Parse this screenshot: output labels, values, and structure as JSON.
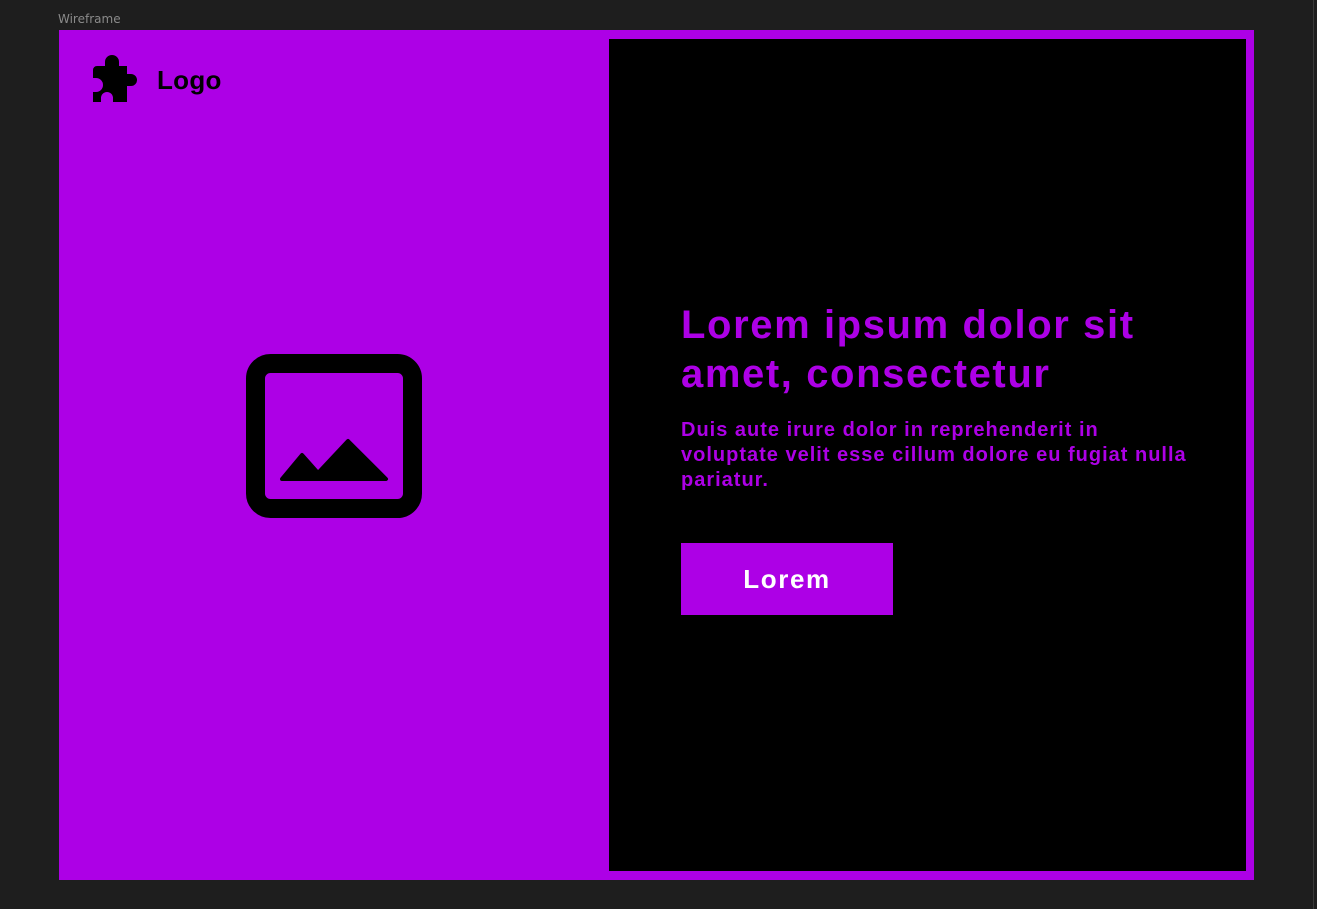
{
  "canvas": {
    "frame_label": "Wireframe",
    "background_color": "#1e1e1e"
  },
  "brand": {
    "accent_color": "#ad00e6",
    "panel_color": "#000000"
  },
  "logo": {
    "icon": "puzzle-piece-icon",
    "text": "Logo"
  },
  "hero_image": {
    "icon": "image-placeholder-icon"
  },
  "content": {
    "headline": "Lorem ipsum dolor sit amet, consectetur",
    "body": "Duis aute irure dolor in reprehenderit in voluptate velit esse cillum dolore eu fugiat nulla pariatur.",
    "cta_label": "Lorem"
  }
}
